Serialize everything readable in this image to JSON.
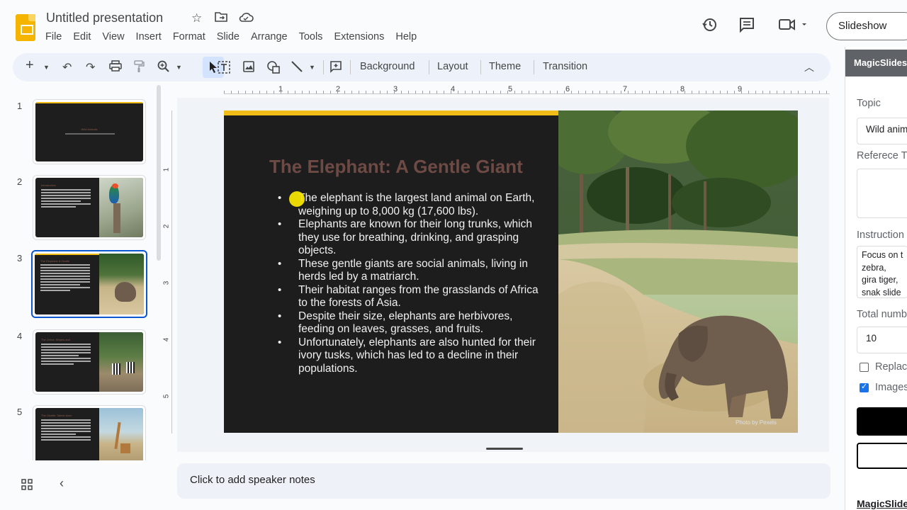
{
  "header": {
    "title": "Untitled presentation",
    "menu": [
      "File",
      "Edit",
      "View",
      "Insert",
      "Format",
      "Slide",
      "Arrange",
      "Tools",
      "Extensions",
      "Help"
    ],
    "slideshow_label": "Slideshow"
  },
  "toolbar": {
    "background_label": "Background",
    "layout_label": "Layout",
    "theme_label": "Theme",
    "transition_label": "Transition"
  },
  "ruler": {
    "h": [
      "1",
      "2",
      "3",
      "4",
      "5",
      "6",
      "7",
      "8",
      "9"
    ],
    "v": [
      "1",
      "2",
      "3",
      "4",
      "5"
    ]
  },
  "filmstrip": {
    "slides": [
      {
        "num": "1",
        "title": "Wild Animals"
      },
      {
        "num": "2",
        "title": "Introduction"
      },
      {
        "num": "3",
        "title": "The Elephant: A Gentle"
      },
      {
        "num": "4",
        "title": "The Zebra: Stripes and"
      },
      {
        "num": "5",
        "title": "The Giraffe: Tallest Anim"
      }
    ]
  },
  "slide": {
    "title": "The Elephant: A Gentle Giant",
    "bullets": [
      "The elephant is the largest land animal on Earth, weighing up to 8,000 kg (17,600 lbs).",
      "Elephants are known for their long trunks, which they use for breathing, drinking, and grasping objects.",
      "These gentle giants are social animals, living in herds led by a matriarch.",
      "Their habitat ranges from the grasslands of Africa to the forests of Asia.",
      "Despite their size, elephants are herbivores, feeding on leaves, grasses, and fruits.",
      "Unfortunately, elephants are also hunted for their ivory tusks, which has led to a decline in their populations."
    ],
    "photo_credit": "Photo by Pexels"
  },
  "notes": {
    "placeholder": "Click to add speaker notes"
  },
  "side_panel": {
    "title": "MagicSlides",
    "topic_label": "Topic",
    "topic_value": "Wild anim",
    "reference_label": "Referece T",
    "instructions_label": "Instruction",
    "instructions_value": "Focus on t zebra, gira tiger, snak slide and a",
    "total_label": "Total numb",
    "total_value": "10",
    "replace_label": "Replac",
    "images_label": "Images",
    "footer_label": "MagicSlide"
  },
  "colors": {
    "accent": "#0b57d0",
    "slide_bar": "#f1bc16",
    "slide_bg": "#1d1d1d",
    "slide_title": "#6e4a45"
  }
}
